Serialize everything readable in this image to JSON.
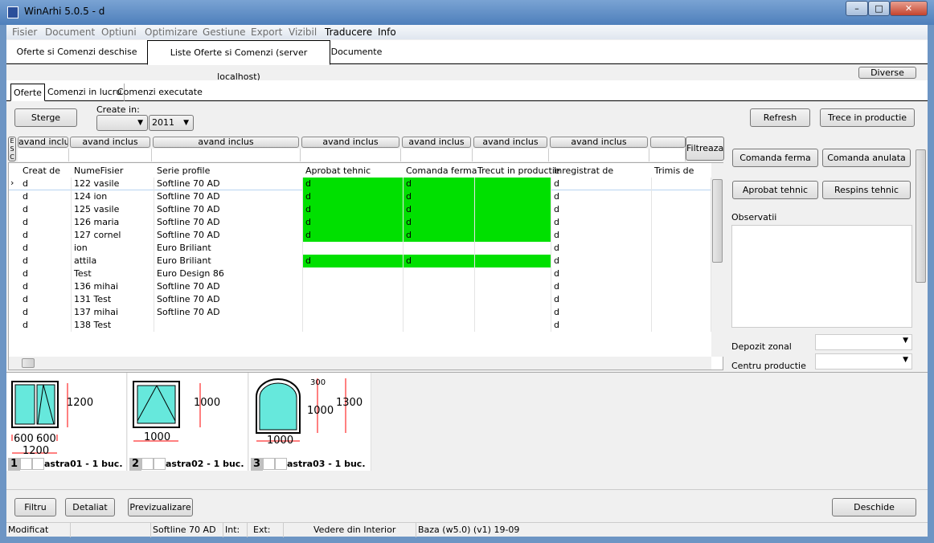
{
  "window": {
    "title": "WinArhi 5.0.5 - d",
    "minimize": "–",
    "maximize": "□",
    "close": "✕"
  },
  "menu": [
    {
      "label": "Fisier",
      "enabled": false
    },
    {
      "label": "Document",
      "enabled": false
    },
    {
      "label": "Optiuni",
      "enabled": false
    },
    {
      "label": "Optimizare",
      "enabled": false
    },
    {
      "label": "Gestiune",
      "enabled": false
    },
    {
      "label": "Export",
      "enabled": false
    },
    {
      "label": "Vizibil",
      "enabled": false
    },
    {
      "label": "Traducere",
      "enabled": true
    },
    {
      "label": "Info",
      "enabled": true
    }
  ],
  "main_tabs": [
    "Oferte si Comenzi deschise",
    "Liste Oferte si Comenzi  (server localhost)",
    "Documente"
  ],
  "diverse": "Diverse",
  "sub_tabs": [
    "Oferte",
    "Comenzi in lucru",
    "Comenzi executate"
  ],
  "toolbar": {
    "sterge": "Sterge",
    "create_in": "Create in:",
    "month": "",
    "year": "2011",
    "refresh": "Refresh",
    "trece": "Trece in productie"
  },
  "filter": {
    "esc": "ESC",
    "button_label": "avand inclus",
    "filtreaza": "Filtreaza"
  },
  "columns": [
    "Creat de",
    "NumeFisier",
    "Serie profile",
    "Aprobat tehnic",
    "Comanda ferma",
    "Trecut in productie",
    "Inregistrat de",
    "Trimis de"
  ],
  "rows": [
    [
      "d",
      "122 vasile",
      "Softline 70 AD",
      "d",
      "d",
      "",
      "d",
      ""
    ],
    [
      "d",
      "124 ion",
      "Softline 70 AD",
      "d",
      "d",
      "",
      "d",
      ""
    ],
    [
      "d",
      "125 vasile",
      "Softline 70 AD",
      "d",
      "d",
      "",
      "d",
      ""
    ],
    [
      "d",
      "126 maria",
      "Softline 70 AD",
      "d",
      "d",
      "",
      "d",
      ""
    ],
    [
      "d",
      "127 cornel",
      "Softline 70 AD",
      "d",
      "d",
      "",
      "d",
      ""
    ],
    [
      "d",
      "ion",
      "Euro Briliant",
      "",
      "",
      "",
      "d",
      ""
    ],
    [
      "d",
      "attila",
      "Euro Briliant",
      "d",
      "d",
      "",
      "d",
      ""
    ],
    [
      "d",
      "Test",
      "Euro Design 86",
      "",
      "",
      "",
      "d",
      ""
    ],
    [
      "d",
      "136 mihai",
      "Softline 70 AD",
      "",
      "",
      "",
      "d",
      ""
    ],
    [
      "d",
      "131 Test",
      "Softline 70 AD",
      "",
      "",
      "",
      "d",
      ""
    ],
    [
      "d",
      "137 mihai",
      "Softline 70 AD",
      "",
      "",
      "",
      "d",
      ""
    ],
    [
      "d",
      "138 Test",
      "",
      "",
      "",
      "",
      "d",
      ""
    ]
  ],
  "green_rows": [
    0,
    1,
    2,
    3,
    4,
    6
  ],
  "highlight_color": "#00e000",
  "side": {
    "comanda_ferma": "Comanda ferma",
    "comanda_anulata": "Comanda anulata",
    "aprobat": "Aprobat tehnic",
    "respins": "Respins tehnic",
    "observatii": "Observatii",
    "depozit": "Depozit zonal",
    "centru": "Centru productie"
  },
  "drawings": [
    {
      "num": "1",
      "label": "astra01 - 1 buc.",
      "height": "1200",
      "widths": [
        "600",
        "600"
      ],
      "total": "1200"
    },
    {
      "num": "2",
      "label": "astra02 - 1 buc.",
      "height": "1000",
      "total": "1000"
    },
    {
      "num": "3",
      "label": "astra03 - 1 buc.",
      "arch": "300",
      "height": "1000",
      "overall": "1300",
      "total": "1000"
    }
  ],
  "bottom": {
    "filtru": "Filtru",
    "detaliat": "Detaliat",
    "previzualizare": "Previzualizare",
    "deschide": "Deschide"
  },
  "status": {
    "modificat": "Modificat",
    "profile": "Softline 70 AD",
    "int": "Int:",
    "ext": "Ext:",
    "view": "Vedere din Interior",
    "baza": "Baza (w5.0) (v1) 19-09"
  }
}
